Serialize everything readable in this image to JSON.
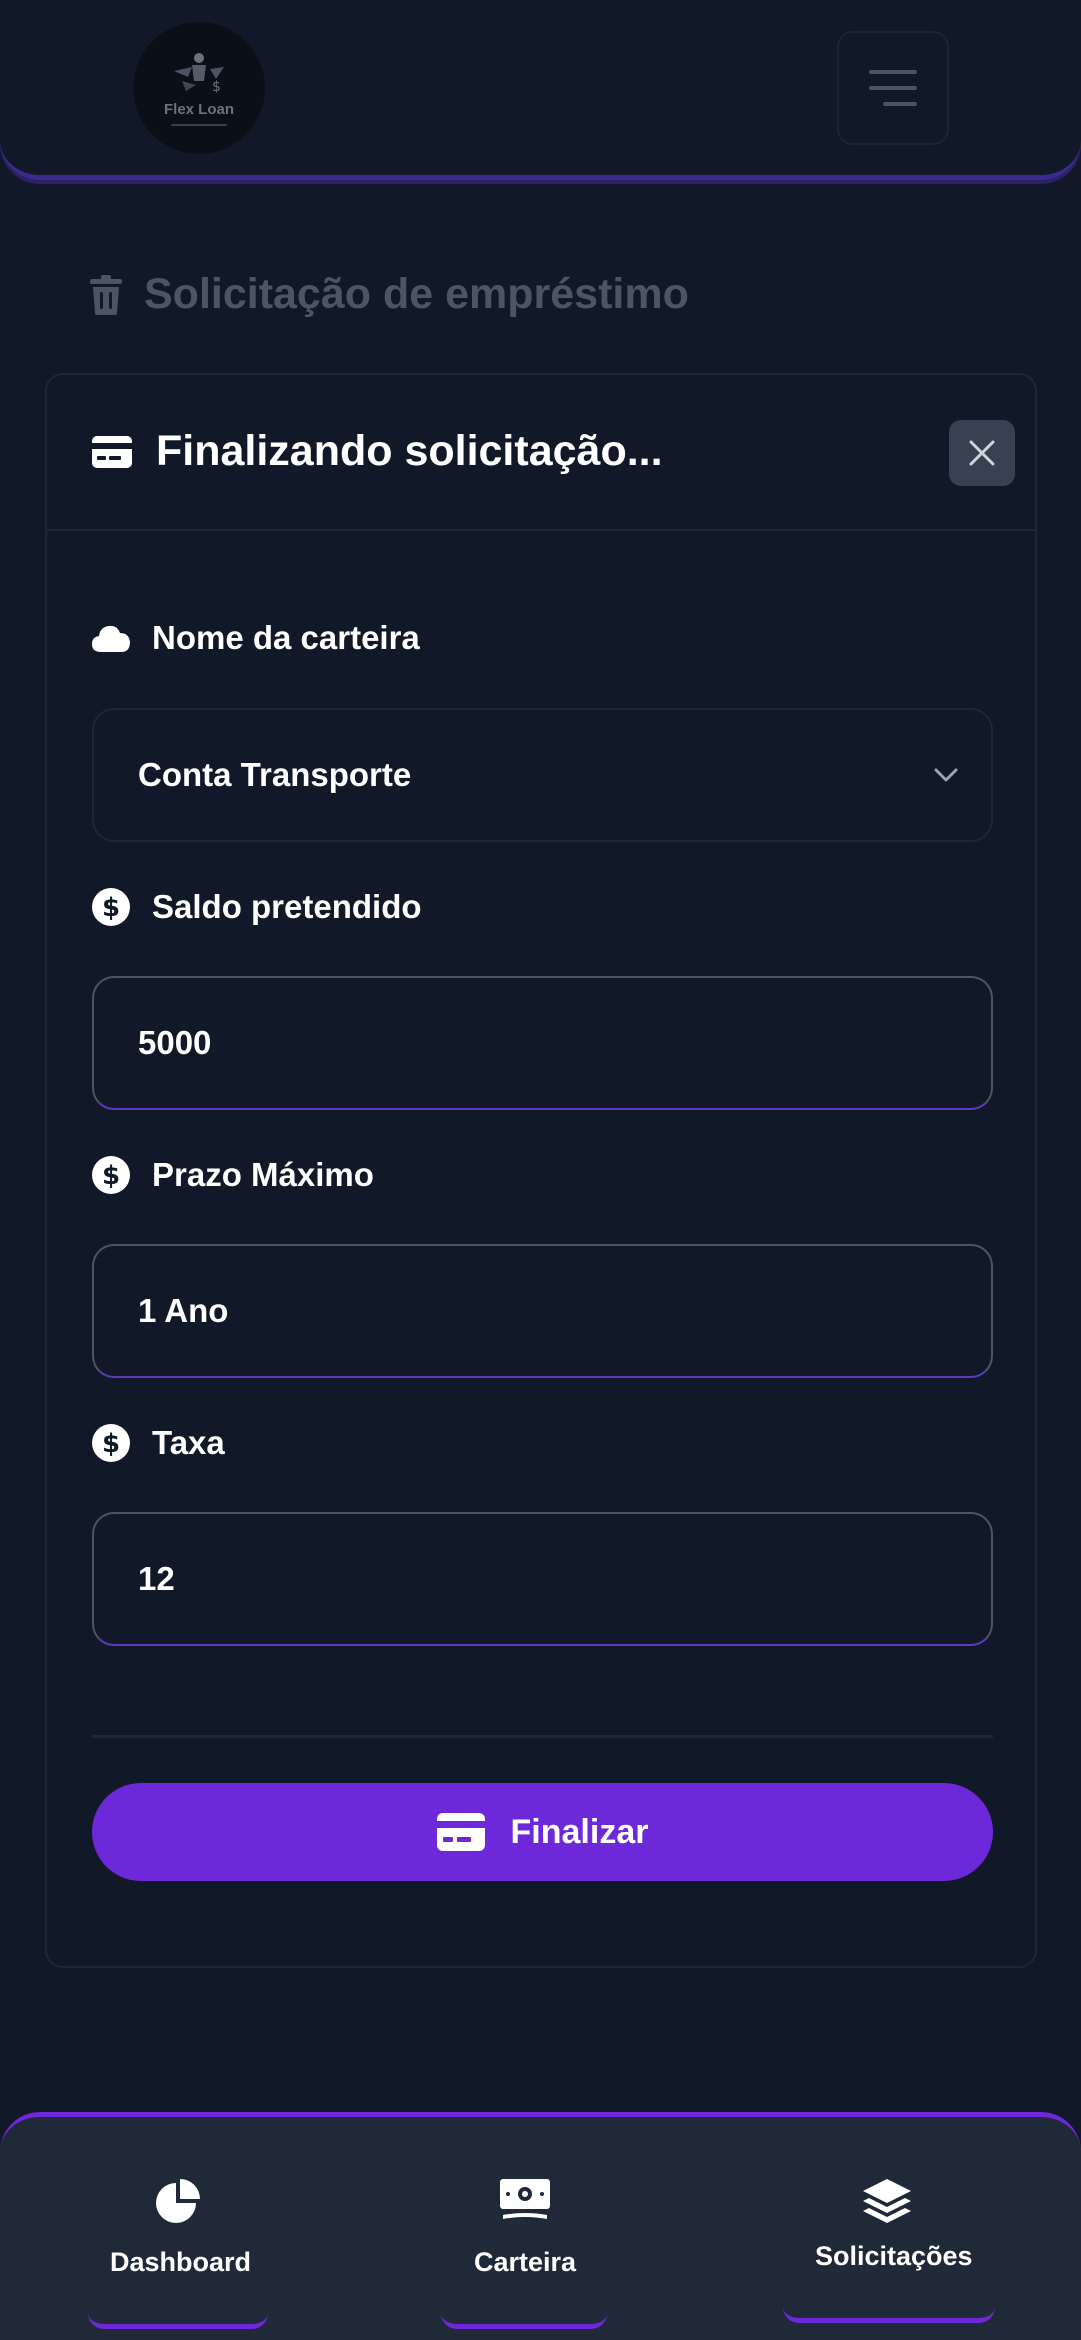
{
  "header": {
    "logo_text": "Flex Loan",
    "logo_icon": "dollar-wing-logo",
    "menu_icon": "hamburger-menu-icon"
  },
  "page": {
    "title": "Solicitação de empréstimo",
    "title_icon": "trash-icon"
  },
  "card": {
    "title": "Finalizando solicitação...",
    "title_icon": "credit-card-icon",
    "close_icon": "close-icon",
    "fields": {
      "wallet": {
        "label": "Nome da carteira",
        "icon": "cloud-icon",
        "value": "Conta Transporte"
      },
      "amount": {
        "label": "Saldo pretendido",
        "icon": "dollar-circle-icon",
        "value": "5000"
      },
      "term": {
        "label": "Prazo Máximo",
        "icon": "dollar-circle-icon",
        "value": "1 Ano"
      },
      "rate": {
        "label": "Taxa",
        "icon": "dollar-circle-icon",
        "value": "12"
      }
    },
    "submit_label": "Finalizar"
  },
  "nav": {
    "items": [
      {
        "label": "Dashboard",
        "icon": "pie-chart-icon"
      },
      {
        "label": "Carteira",
        "icon": "money-bill-icon"
      },
      {
        "label": "Solicitações",
        "icon": "layers-icon"
      }
    ]
  },
  "colors": {
    "background": "#111827",
    "accent": "#6d28d9",
    "nav_background": "#1f2937",
    "muted": "#4b5563"
  }
}
